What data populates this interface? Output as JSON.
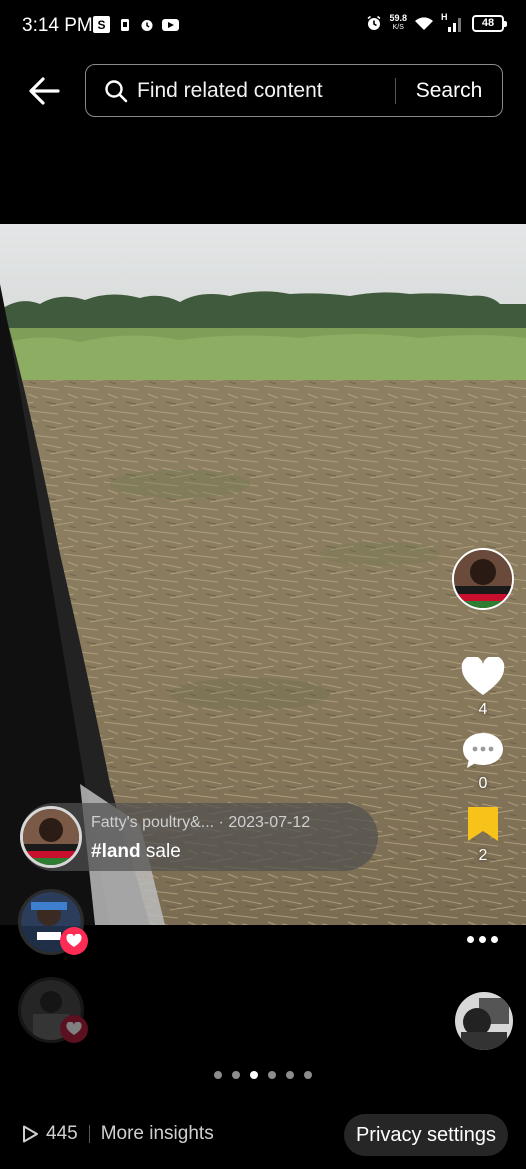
{
  "status_bar": {
    "time": "3:14 PM",
    "net_speed_value": "59.8",
    "net_speed_unit": "K/S",
    "network_type": "H",
    "battery": "48",
    "icons": [
      "s-app-icon",
      "sim-icon",
      "alarm-icon",
      "youtube-icon",
      "alarm-clock-icon",
      "wifi-icon",
      "signal-icon",
      "battery-icon"
    ]
  },
  "topbar": {
    "back_icon": "arrow-left-icon",
    "search_placeholder": "Find related content",
    "search_button": "Search"
  },
  "video": {
    "scene": "cleared-land-field"
  },
  "rail": {
    "likes": "4",
    "comments": "0",
    "saves": "2"
  },
  "caption": {
    "author": "Fatty's poultry&...",
    "date": "· 2023-07-12",
    "hashtag": "#land",
    "text": " sale"
  },
  "pagination": {
    "total": 6,
    "active": 3
  },
  "bottom_bar": {
    "views": "445",
    "insights": "More insights",
    "privacy": "Privacy settings"
  },
  "colors": {
    "background": "#000000",
    "like_badge": "#fe2c55",
    "bookmark": "#f7c21a"
  }
}
